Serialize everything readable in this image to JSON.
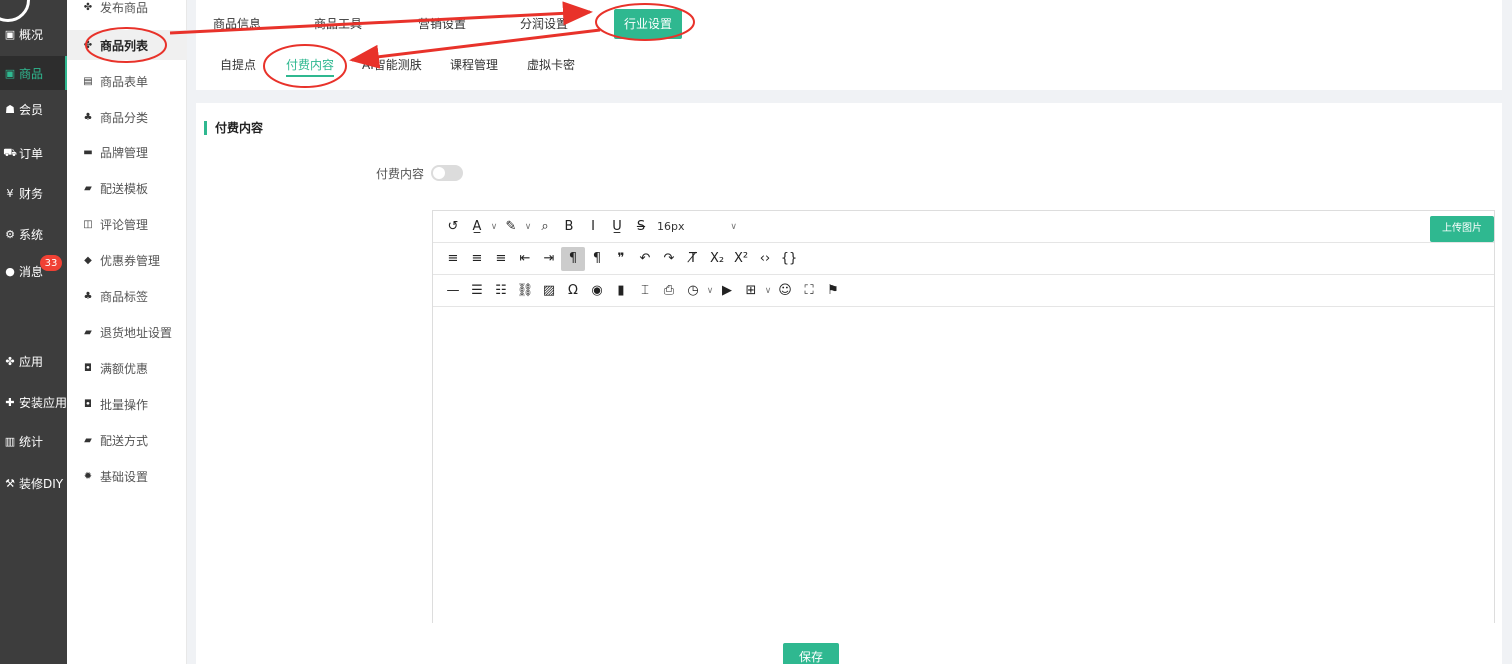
{
  "nav": {
    "items": [
      {
        "icon": "panel-icon",
        "glyph": "▣",
        "label": "概况"
      },
      {
        "icon": "goods-icon",
        "glyph": "▣",
        "label": "商品",
        "active": true
      },
      {
        "icon": "members-icon",
        "glyph": "☗",
        "label": "会员"
      },
      {
        "icon": "cart-icon",
        "glyph": "⛟",
        "label": "订单"
      },
      {
        "icon": "yen-icon",
        "glyph": "¥",
        "label": "财务"
      },
      {
        "icon": "gears-icon",
        "glyph": "⚙",
        "label": "系统"
      },
      {
        "icon": "chat-icon",
        "glyph": "●",
        "label": "消息"
      },
      {
        "icon": "apps-icon",
        "glyph": "✤",
        "label": "应用"
      },
      {
        "icon": "puzzle-icon",
        "glyph": "✚",
        "label": "安装应用"
      },
      {
        "icon": "bar-chart-icon",
        "glyph": "▥",
        "label": "统计"
      },
      {
        "icon": "hammer-icon",
        "glyph": "⚒",
        "label": "装修DIY"
      }
    ],
    "message_badge": "33"
  },
  "submenu": {
    "items": [
      {
        "icon": "cubes-icon",
        "glyph": "✤",
        "label": "发布商品"
      },
      {
        "icon": "cubes-icon",
        "glyph": "✤",
        "label": "商品列表",
        "active": true
      },
      {
        "icon": "file-excel-icon",
        "glyph": "▤",
        "label": "商品表单"
      },
      {
        "icon": "sitemap-icon",
        "glyph": "♣",
        "label": "商品分类"
      },
      {
        "icon": "briefcase-icon",
        "glyph": "▬",
        "label": "品牌管理"
      },
      {
        "icon": "truck-icon",
        "glyph": "▰",
        "label": "配送模板"
      },
      {
        "icon": "columns-icon",
        "glyph": "◫",
        "label": "评论管理"
      },
      {
        "icon": "tag-icon",
        "glyph": "◆",
        "label": "优惠券管理"
      },
      {
        "icon": "sitemap-icon",
        "glyph": "♣",
        "label": "商品标签"
      },
      {
        "icon": "truck-icon",
        "glyph": "▰",
        "label": "退货地址设置"
      },
      {
        "icon": "gift-icon",
        "glyph": "◘",
        "label": "满额优惠"
      },
      {
        "icon": "gift-icon",
        "glyph": "◘",
        "label": "批量操作"
      },
      {
        "icon": "truck-icon",
        "glyph": "▰",
        "label": "配送方式"
      },
      {
        "icon": "cog-icon",
        "glyph": "✹",
        "label": "基础设置"
      }
    ]
  },
  "tabs": [
    {
      "label": "商品信息"
    },
    {
      "label": "商品工具"
    },
    {
      "label": "营销设置"
    },
    {
      "label": "分润设置"
    },
    {
      "label": "行业设置",
      "active": true
    }
  ],
  "subtabs": [
    {
      "label": "自提点"
    },
    {
      "label": "付费内容",
      "active": true
    },
    {
      "label": "AI智能测肤"
    },
    {
      "label": "课程管理"
    },
    {
      "label": "虚拟卡密"
    }
  ],
  "content": {
    "section_title": "付费内容",
    "field_label": "付费内容",
    "switch_on": false
  },
  "editor": {
    "font_size": "16px",
    "upload_label": "上传图片",
    "row1": [
      {
        "name": "history-icon",
        "g": "↺"
      },
      {
        "name": "font-color-icon",
        "g": "A̲"
      },
      {
        "name": "font-color-caret-icon",
        "g": "∨",
        "caret": true
      },
      {
        "name": "highlight-icon",
        "g": "✎"
      },
      {
        "name": "highlight-caret-icon",
        "g": "∨",
        "caret": true
      },
      {
        "name": "find-icon",
        "g": "⌕"
      },
      {
        "name": "bold-icon",
        "g": "B"
      },
      {
        "name": "italic-icon",
        "g": "I"
      },
      {
        "name": "underline-icon",
        "g": "U̲"
      },
      {
        "name": "strikethrough-icon",
        "g": "S̶"
      }
    ],
    "row2": [
      {
        "name": "align-left-icon",
        "g": "≡"
      },
      {
        "name": "align-center-icon",
        "g": "≡"
      },
      {
        "name": "align-right-icon",
        "g": "≡"
      },
      {
        "name": "outdent-icon",
        "g": "⇤"
      },
      {
        "name": "indent-icon",
        "g": "⇥"
      },
      {
        "name": "ltr-icon",
        "g": "¶",
        "active": true
      },
      {
        "name": "rtl-icon",
        "g": "¶"
      },
      {
        "name": "blockquote-icon",
        "g": "❞"
      },
      {
        "name": "undo-icon",
        "g": "↶"
      },
      {
        "name": "redo-icon",
        "g": "↷"
      },
      {
        "name": "clear-format-icon",
        "g": "T̸"
      },
      {
        "name": "subscript-icon",
        "g": "X₂"
      },
      {
        "name": "superscript-icon",
        "g": "X²"
      },
      {
        "name": "code-icon",
        "g": "‹›"
      },
      {
        "name": "code-block-icon",
        "g": "{}"
      }
    ],
    "row3": [
      {
        "name": "horizontal-rule-icon",
        "g": "—"
      },
      {
        "name": "bulleted-list-icon",
        "g": "☰"
      },
      {
        "name": "numbered-list-icon",
        "g": "☷"
      },
      {
        "name": "link-icon",
        "g": "⛓"
      },
      {
        "name": "image-icon",
        "g": "▨"
      },
      {
        "name": "special-char-icon",
        "g": "Ω"
      },
      {
        "name": "preview-icon",
        "g": "◉"
      },
      {
        "name": "bookmark-icon",
        "g": "▮"
      },
      {
        "name": "page-break-icon",
        "g": "⌶"
      },
      {
        "name": "print-icon",
        "g": "⎙"
      },
      {
        "name": "time-icon",
        "g": "◷"
      },
      {
        "name": "time-caret-icon",
        "g": "∨",
        "caret": true
      },
      {
        "name": "media-icon",
        "g": "▶"
      },
      {
        "name": "table-icon",
        "g": "⊞"
      },
      {
        "name": "table-caret-icon",
        "g": "∨",
        "caret": true
      },
      {
        "name": "emoji-icon",
        "g": "☺"
      },
      {
        "name": "fullscreen-icon",
        "g": "⛶"
      },
      {
        "name": "format-painter-icon",
        "g": "⚑"
      }
    ]
  },
  "save_label": "保存",
  "colors": {
    "accent": "#2fb890",
    "annotation": "#e8322a",
    "nav_bg": "#3d3d3d"
  }
}
